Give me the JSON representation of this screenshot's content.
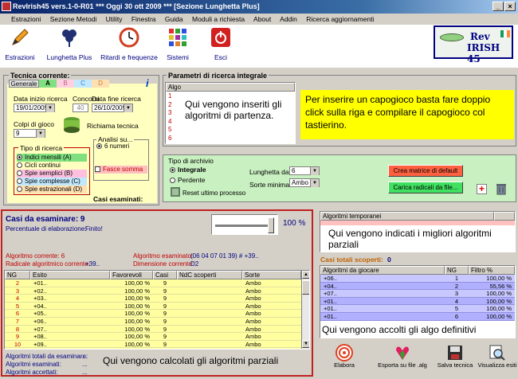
{
  "title_bar": {
    "title": "RevIrish45 vers.1-0-R01   ***  Oggi 30 ott 2009   ***  [Sezione Lunghetta Plus]"
  },
  "menu": [
    "Estrazioni",
    "Sezione Metodi",
    "Utility",
    "Finestra",
    "Guida",
    "Moduli a richiesta",
    "About",
    "Addin",
    "Ricerca aggiornamenti"
  ],
  "toolbar": [
    {
      "label": "Estrazioni",
      "icon": "pencil-icon"
    },
    {
      "label": "Lunghetta Plus",
      "icon": "clover-icon"
    },
    {
      "label": "Ritardi e frequenze",
      "icon": "clock-icon"
    },
    {
      "label": "Sistemi",
      "icon": "grid-icon"
    },
    {
      "label": "Esci",
      "icon": "exit-icon"
    }
  ],
  "logo": {
    "line1": "Rev",
    "line2": "IRISH 45"
  },
  "tecnica": {
    "title": "Tecnica corrente:",
    "tabs": [
      "Generale",
      "A",
      "B",
      "C",
      "D"
    ],
    "data_inizio_label": "Data inizio ricerca",
    "data_inizio": "19/01/2009",
    "concorsi_label": "Concorsi",
    "concorsi": "40",
    "data_fine_label": "Data fine ricerca",
    "data_fine": "26/10/2009",
    "colpi_label": "Colpi di gioco",
    "colpi": "9",
    "richiama_label": "Richiama tecnica",
    "tipo_ricerca_label": "Tipo di ricerca",
    "tipo_ricerca": [
      "Indici mensili (A)",
      "Cicli continui",
      "Spie semplici (B)",
      "Spie complesse (C)",
      "Spie estrazionali (D)"
    ],
    "analisi_label": "Analisi su...",
    "analisi_option": "6 numeri",
    "fasce_label": "Fasce somma",
    "casi_esaminati_label": "Casi esaminati:"
  },
  "parametri": {
    "title": "Parametri di ricerca integrale",
    "algo_header": "Algo",
    "rows": [
      "1",
      "2",
      "3",
      "4",
      "5",
      "6"
    ],
    "note_algo": "Qui vengono inseriti gli algoritmi di partenza.",
    "note_capogioco": "Per inserire un capogioco basta fare doppio click sulla riga e compilare il capogioco col tastierino."
  },
  "archivio": {
    "title": "Tipo di archivio",
    "integrale": "Integrale",
    "perdente": "Perdente",
    "reset": "Reset ultimo processo",
    "lunghetta_label": "Lunghetta da",
    "lunghetta": "6",
    "sorte_label": "Sorte minima",
    "sorte": "Ambo",
    "crea_btn": "Crea matrice di default",
    "carica_btn": "Carica radicali da file..."
  },
  "elaborazione": {
    "casi_label": "Casi da esaminare: 9",
    "percentuale_label": "Percentuale di elaborazione:",
    "percentuale_status": "Finito!",
    "percent": "100 %",
    "progress": 1.0,
    "algoritmo_corrente": "Algoritmo corrente: 6",
    "algoritmo_esaminato_label": "Algoritmo esaminato:",
    "algoritmo_esaminato": "(06 04 07 01 39) # +39..",
    "radicale_label": "Radicale algoritmico corrente:",
    "radicale": "+39..",
    "dimensione_label": "Dimensione corrente:",
    "dimensione": "D2"
  },
  "results": {
    "headers": [
      "NG",
      "Esito",
      "Favorevoli",
      "Casi",
      "NdC scoperti",
      "Sorte"
    ],
    "rows": [
      [
        "2",
        "+01..",
        "100,00 %",
        "9",
        "",
        "Ambo"
      ],
      [
        "3",
        "+02..",
        "100,00 %",
        "9",
        "",
        "Ambo"
      ],
      [
        "4",
        "+03..",
        "100,00 %",
        "9",
        "",
        "Ambo"
      ],
      [
        "5",
        "+04..",
        "100,00 %",
        "9",
        "",
        "Ambo"
      ],
      [
        "6",
        "+05..",
        "100,00 %",
        "9",
        "",
        "Ambo"
      ],
      [
        "7",
        "+06..",
        "100,00 %",
        "9",
        "",
        "Ambo"
      ],
      [
        "8",
        "+07..",
        "100,00 %",
        "9",
        "",
        "Ambo"
      ],
      [
        "9",
        "+08..",
        "100,00 %",
        "9",
        "",
        "Ambo"
      ],
      [
        "10",
        "+09..",
        "100,00 %",
        "9",
        "",
        "Ambo"
      ]
    ]
  },
  "footer_left": {
    "totali": "Algoritmi totali da esaminare:",
    "esaminati": "Algoritmi esaminati:",
    "accettati": "Algoritmi accettati:",
    "dots": "...",
    "note": "Qui vengono calcolati gli algoritmi parziali"
  },
  "temporanei": {
    "title": "Algoritmi temporanei",
    "note": "Qui vengono indicati i migliori algoritmi parziali"
  },
  "scoperti": {
    "label": "Casi totali scoperti:",
    "value": "0",
    "headers": [
      "Algoritmi da giocare",
      "NG",
      "Filtro %"
    ],
    "rows": [
      [
        "+06..",
        "1",
        "100,00 %"
      ],
      [
        "+04..",
        "2",
        "55,56 %"
      ],
      [
        "+07..",
        "3",
        "100,00 %"
      ],
      [
        "+01..",
        "4",
        "100,00 %"
      ],
      [
        "+01..",
        "5",
        "100,00 %"
      ],
      [
        "+01..",
        "6",
        "100,00 %"
      ]
    ],
    "note": "Qui vengono accolti gli algo definitivi"
  },
  "bottom_buttons": [
    "Elabora",
    "Esporta su file .alg",
    "Salva tecnica",
    "Visualizza esiti"
  ]
}
